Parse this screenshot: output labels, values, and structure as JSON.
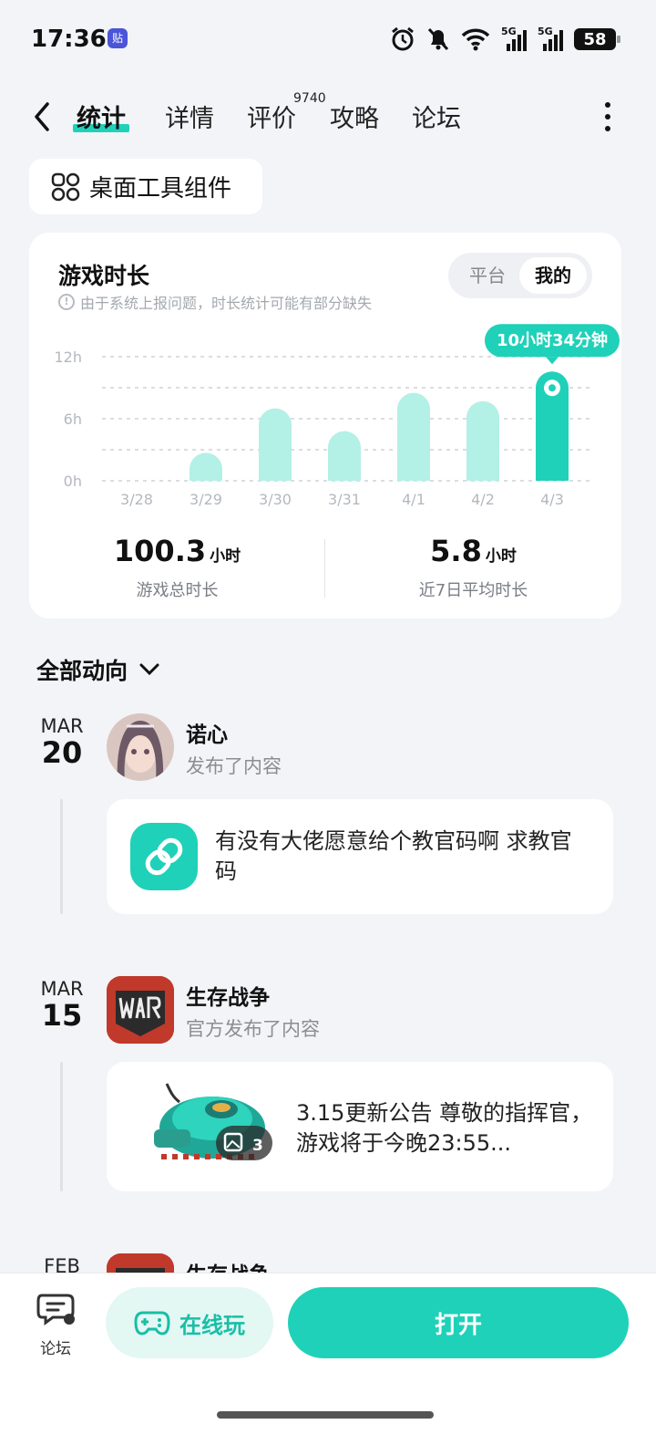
{
  "status_bar": {
    "time": "17:36",
    "note_badge": "贴",
    "battery": "58",
    "sig_label": "5G"
  },
  "tabs": [
    {
      "label": "统计",
      "active": true
    },
    {
      "label": "详情",
      "active": false
    },
    {
      "label": "评价",
      "active": false,
      "count": "9740"
    },
    {
      "label": "攻略",
      "active": false
    },
    {
      "label": "论坛",
      "active": false
    }
  ],
  "widget_button": {
    "label": "桌面工具组件"
  },
  "playtime": {
    "title": "游戏时长",
    "note": "由于系统上报问题，时长统计可能有部分缺失",
    "toggle": {
      "platform": "平台",
      "mine": "我的",
      "selected": "我的"
    },
    "total": {
      "value": "100.3",
      "unit": "小时",
      "caption": "游戏总时长"
    },
    "avg": {
      "value": "5.8",
      "unit": "小时",
      "caption": "近7日平均时长"
    }
  },
  "chart_data": {
    "type": "bar",
    "categories": [
      "3/28",
      "3/29",
      "3/30",
      "3/31",
      "4/1",
      "4/2",
      "4/3"
    ],
    "values": [
      0,
      2.7,
      7,
      4.8,
      8.5,
      7.7,
      10.57
    ],
    "y_ticks": [
      "12h",
      "6h",
      "0h"
    ],
    "ylim": [
      0,
      12
    ],
    "highlight_index": 6,
    "highlight_label": "10小时34分钟",
    "bar_color": "#b3f0e6",
    "highlight_color": "#1fd1b9",
    "grid": true
  },
  "feed": {
    "header": "全部动向",
    "entries": [
      {
        "month": "MAR",
        "day": "20",
        "author": "诺心",
        "action": "发布了内容",
        "text": "有没有大佬愿意给个教官码啊 求教官码"
      },
      {
        "month": "MAR",
        "day": "15",
        "author": "生存战争",
        "action": "官方发布了内容",
        "text": "3.15更新公告 尊敬的指挥官， 游戏将于今晚23:55...",
        "image_count": "3"
      },
      {
        "month": "FEB",
        "day": "",
        "author": "生存战争",
        "action": ""
      }
    ]
  },
  "bottom_bar": {
    "forum": "论坛",
    "online_play": "在线玩",
    "open": "打开"
  },
  "colors": {
    "accent": "#1fd1b9",
    "bg": "#f2f4f7"
  }
}
